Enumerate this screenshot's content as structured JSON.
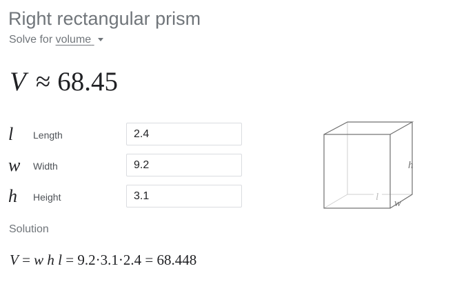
{
  "header": {
    "title": "Right rectangular prism",
    "solve_prefix": "Solve for",
    "solve_target": "volume"
  },
  "result": {
    "symbol": "V",
    "relation": "≈",
    "value": "68.45"
  },
  "variables": [
    {
      "symbol": "l",
      "label": "Length",
      "value": "2.4"
    },
    {
      "symbol": "w",
      "label": "Width",
      "value": "9.2"
    },
    {
      "symbol": "h",
      "label": "Height",
      "value": "3.1"
    }
  ],
  "solution": {
    "label": "Solution",
    "equation": {
      "lhs": "V",
      "formula": "w h l",
      "numeric": "9.2·3.1·2.4",
      "result": "68.448"
    }
  },
  "diagram": {
    "labels": {
      "h": "h",
      "l": "l",
      "w": "w"
    },
    "colors": {
      "edges": "#6f6f6f",
      "hidden_edges": "#cfcfcf"
    }
  }
}
